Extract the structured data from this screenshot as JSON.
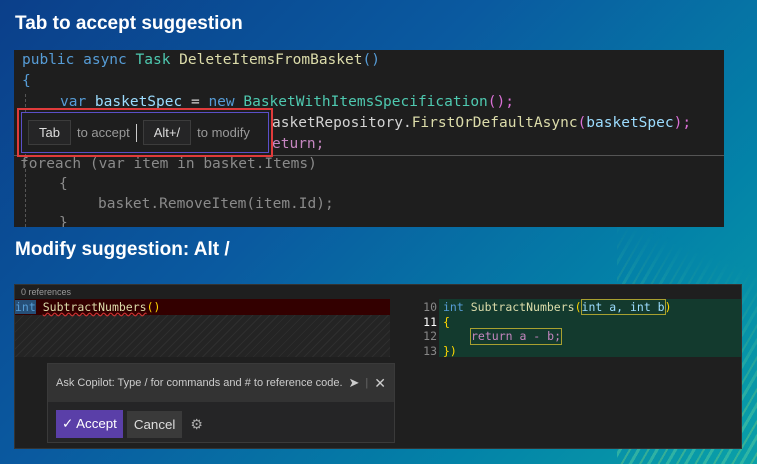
{
  "headings": {
    "first": "Tab to accept suggestion",
    "second": "Modify suggestion: Alt /"
  },
  "editor1": {
    "lines": {
      "l1a": "public async ",
      "l1b": "Task ",
      "l1c": "DeleteItemsFromBasket",
      "l1d": "()",
      "l2": "{",
      "l3a": "var ",
      "l3b": "basketSpec",
      "l3c": " = ",
      "l3d": "new ",
      "l3e": "BasketWithItemsSpecification",
      "l3f": "();",
      "l4a": "asketRepository.",
      "l4b": "FirstOrDefaultAsync",
      "l4c": "(",
      "l4d": "basketSpec",
      "l4e": ");",
      "l5": "eturn;",
      "l6": "foreach (var item in basket.Items)",
      "l7": "{",
      "l8": "basket.RemoveItem(item.Id);",
      "l9": "}"
    },
    "hint": {
      "key1": "Tab",
      "text1": "to accept",
      "key2": "Alt+/",
      "text2": "to modify"
    }
  },
  "editor2": {
    "references": "0 references",
    "left_line": {
      "kw": "int",
      "name": "SubtractNumbers",
      "paren": "()"
    },
    "right_lines": [
      {
        "num": "10",
        "kw": "int",
        "name": "SubtractNumbers",
        "params": "int a, int b"
      },
      {
        "num": "11",
        "code": "{"
      },
      {
        "num": "12",
        "code": "return a - b;"
      },
      {
        "num": "13",
        "code": "})"
      }
    ],
    "copilot": {
      "placeholder": "Ask Copilot: Type / for commands and # to reference code.",
      "accept": "✓ Accept",
      "cancel": "Cancel"
    }
  }
}
